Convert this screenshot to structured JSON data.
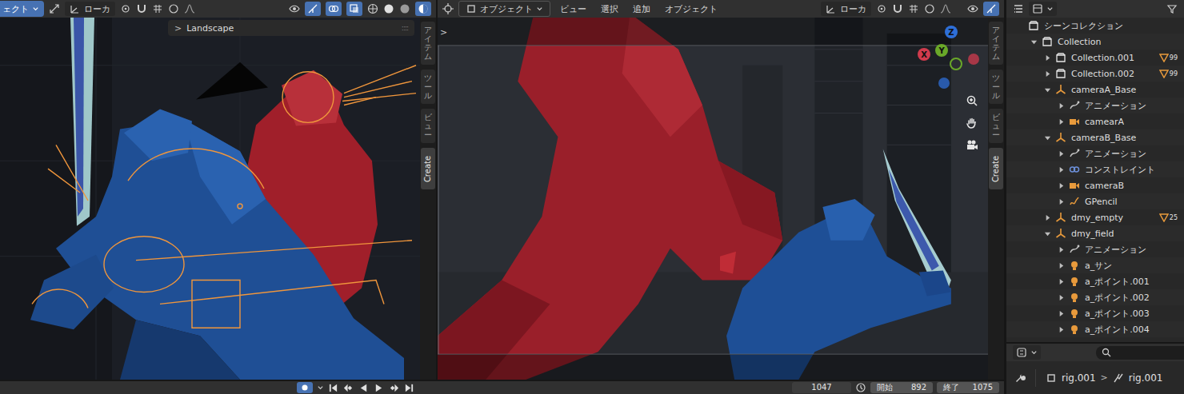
{
  "left_viewport": {
    "header": {
      "mode": "ェクト",
      "orientation": "ローカ"
    },
    "panel": {
      "expand": ">",
      "title": "Landscape",
      "handle": "::::"
    },
    "tabs": [
      {
        "label": "アイテム",
        "selected": false
      },
      {
        "label": "ツール",
        "selected": false
      },
      {
        "label": "ビュー",
        "selected": false
      },
      {
        "label": "Create",
        "selected": true
      }
    ]
  },
  "camera_viewport": {
    "collapse": ">",
    "header": {
      "mode": "オブジェクト",
      "menus": [
        "ビュー",
        "選択",
        "追加",
        "オブジェクト"
      ],
      "orientation": "ローカ"
    },
    "gizmo": [
      {
        "label": "Z",
        "color": "#2e6fd8"
      },
      {
        "label": "Y",
        "color": "#6aa829"
      },
      {
        "label": "X",
        "color": "#d13b4d"
      }
    ],
    "tabs": [
      {
        "label": "アイテム",
        "selected": false
      },
      {
        "label": "ツール",
        "selected": false
      },
      {
        "label": "ビュー",
        "selected": false
      },
      {
        "label": "Create",
        "selected": true
      }
    ]
  },
  "outliner": {
    "rows": [
      {
        "label": "シーンコレクション",
        "depth": 0,
        "kind": "scene",
        "expandable": false,
        "expanded": false
      },
      {
        "label": "Collection",
        "depth": 1,
        "kind": "collection",
        "expandable": true,
        "expanded": true
      },
      {
        "label": "Collection.001",
        "depth": 2,
        "kind": "collection",
        "expandable": true,
        "expanded": false,
        "badge": "99"
      },
      {
        "label": "Collection.002",
        "depth": 2,
        "kind": "collection",
        "expandable": true,
        "expanded": false,
        "badge": "99"
      },
      {
        "label": "cameraA_Base",
        "depth": 2,
        "kind": "empty",
        "expandable": true,
        "expanded": true
      },
      {
        "label": "アニメーション",
        "depth": 3,
        "kind": "action",
        "expandable": true,
        "expanded": false
      },
      {
        "label": "camearA",
        "depth": 3,
        "kind": "camera",
        "expandable": true,
        "expanded": false
      },
      {
        "label": "cameraB_Base",
        "depth": 2,
        "kind": "empty",
        "expandable": true,
        "expanded": true
      },
      {
        "label": "アニメーション",
        "depth": 3,
        "kind": "action",
        "expandable": true,
        "expanded": false
      },
      {
        "label": "コンストレイント",
        "depth": 3,
        "kind": "constraint",
        "expandable": true,
        "expanded": false
      },
      {
        "label": "cameraB",
        "depth": 3,
        "kind": "camera",
        "expandable": true,
        "expanded": false
      },
      {
        "label": "GPencil",
        "depth": 3,
        "kind": "gpencil",
        "expandable": true,
        "expanded": false
      },
      {
        "label": "dmy_empty",
        "depth": 2,
        "kind": "empty",
        "expandable": true,
        "expanded": false,
        "badge": "25"
      },
      {
        "label": "dmy_field",
        "depth": 2,
        "kind": "empty",
        "expandable": true,
        "expanded": true
      },
      {
        "label": "アニメーション",
        "depth": 3,
        "kind": "action",
        "expandable": true,
        "expanded": false
      },
      {
        "label": "a_サン",
        "depth": 3,
        "kind": "light",
        "expandable": true,
        "expanded": false
      },
      {
        "label": "a_ポイント.001",
        "depth": 3,
        "kind": "light",
        "expandable": true,
        "expanded": false
      },
      {
        "label": "a_ポイント.002",
        "depth": 3,
        "kind": "light",
        "expandable": true,
        "expanded": false
      },
      {
        "label": "a_ポイント.003",
        "depth": 3,
        "kind": "light",
        "expandable": true,
        "expanded": false
      },
      {
        "label": "a_ポイント.004",
        "depth": 3,
        "kind": "light",
        "expandable": true,
        "expanded": false
      }
    ]
  },
  "properties": {
    "crumbs": [
      "rig.001",
      "rig.001"
    ],
    "separator": ">"
  },
  "timeline": {
    "auto_key": true,
    "controls": [
      {
        "kind": "jump-start"
      },
      {
        "kind": "key-prev"
      },
      {
        "kind": "play-reverse"
      },
      {
        "kind": "play"
      },
      {
        "kind": "key-next"
      },
      {
        "kind": "jump-end"
      }
    ],
    "frame": "1047",
    "start_label": "開始",
    "start": "892",
    "end_label": "終了",
    "end": "1075"
  }
}
